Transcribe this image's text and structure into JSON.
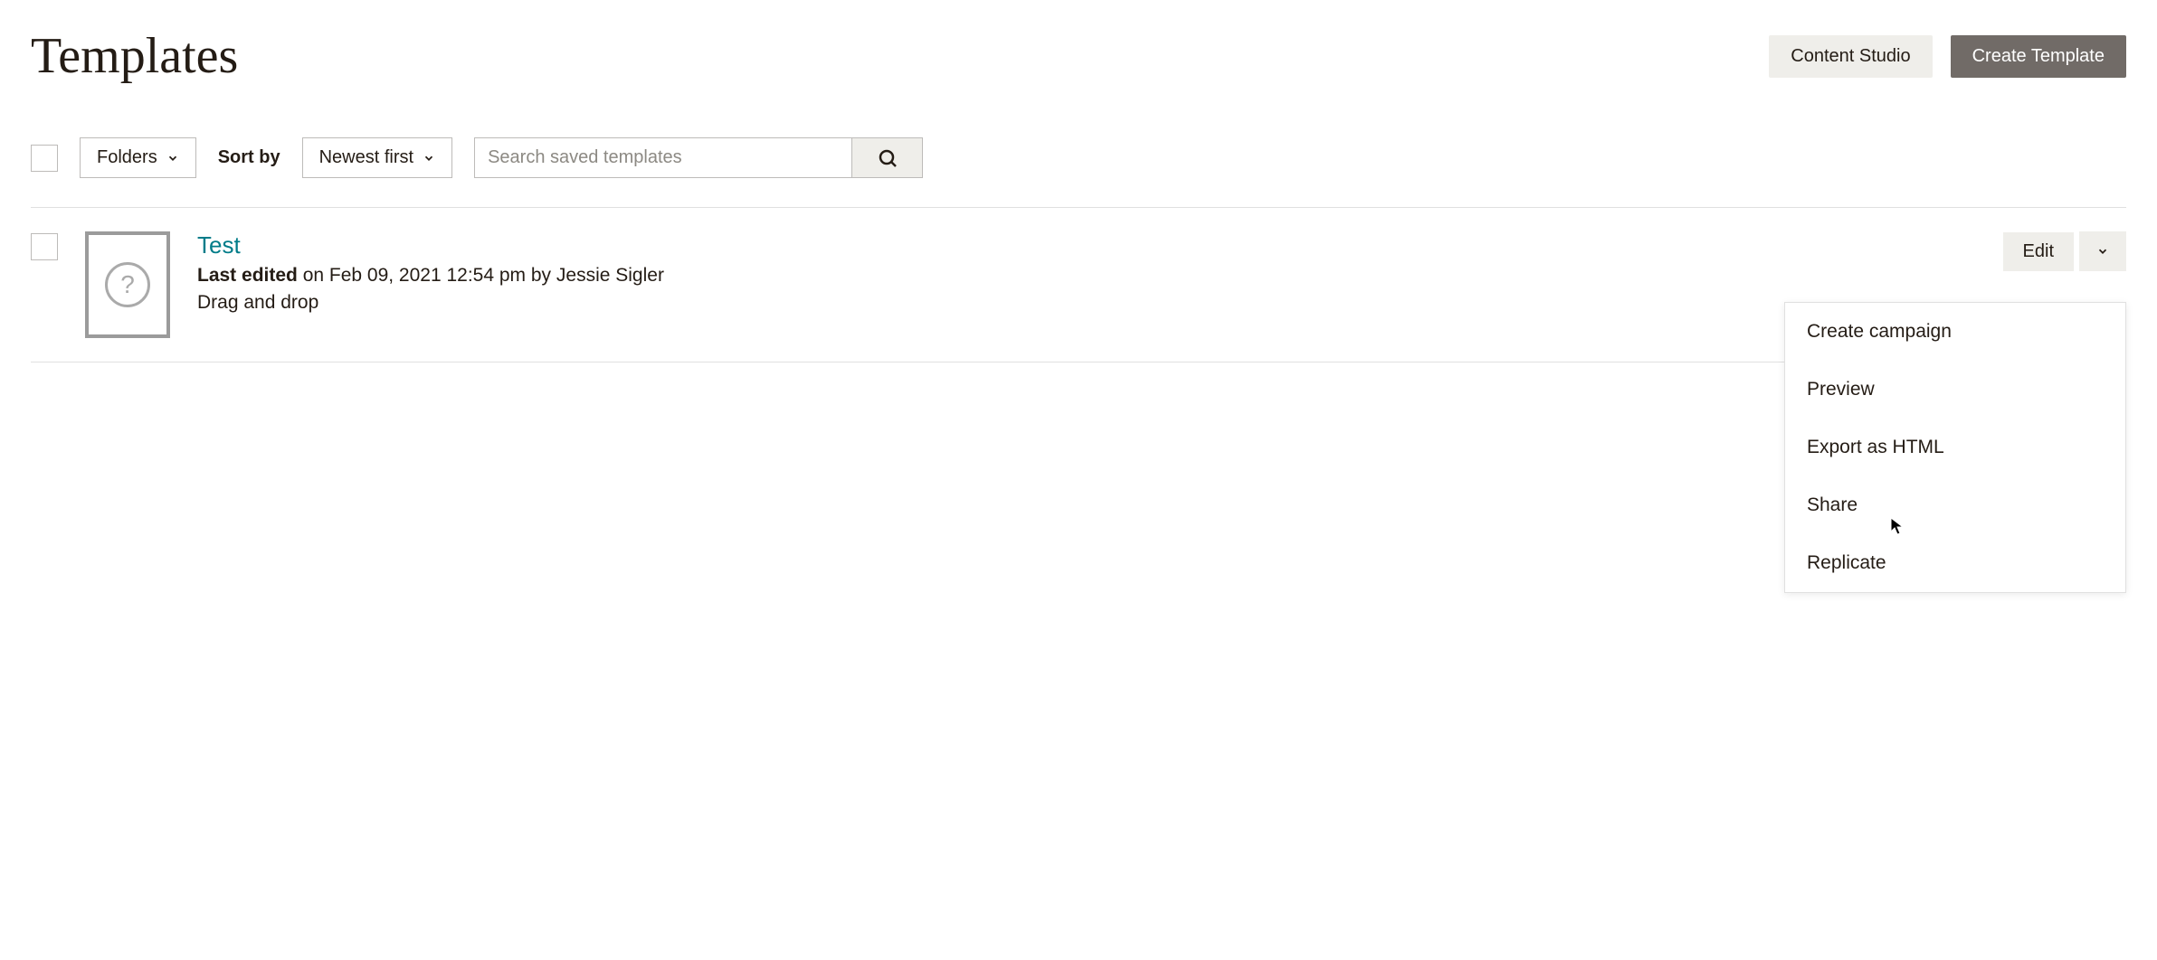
{
  "header": {
    "title": "Templates",
    "content_studio_label": "Content Studio",
    "create_template_label": "Create Template"
  },
  "toolbar": {
    "folders_label": "Folders",
    "sort_by_label": "Sort by",
    "sort_value": "Newest first",
    "search_placeholder": "Search saved templates"
  },
  "template": {
    "name": "Test",
    "last_edited_label": "Last edited",
    "last_edited_meta": " on Feb 09, 2021 12:54 pm by Jessie Sigler",
    "type": "Drag and drop",
    "thumb_mark": "?"
  },
  "row_actions": {
    "edit_label": "Edit"
  },
  "dropdown": {
    "items": [
      {
        "label": "Create campaign"
      },
      {
        "label": "Preview"
      },
      {
        "label": "Export as HTML"
      },
      {
        "label": "Share"
      },
      {
        "label": "Replicate"
      }
    ]
  }
}
